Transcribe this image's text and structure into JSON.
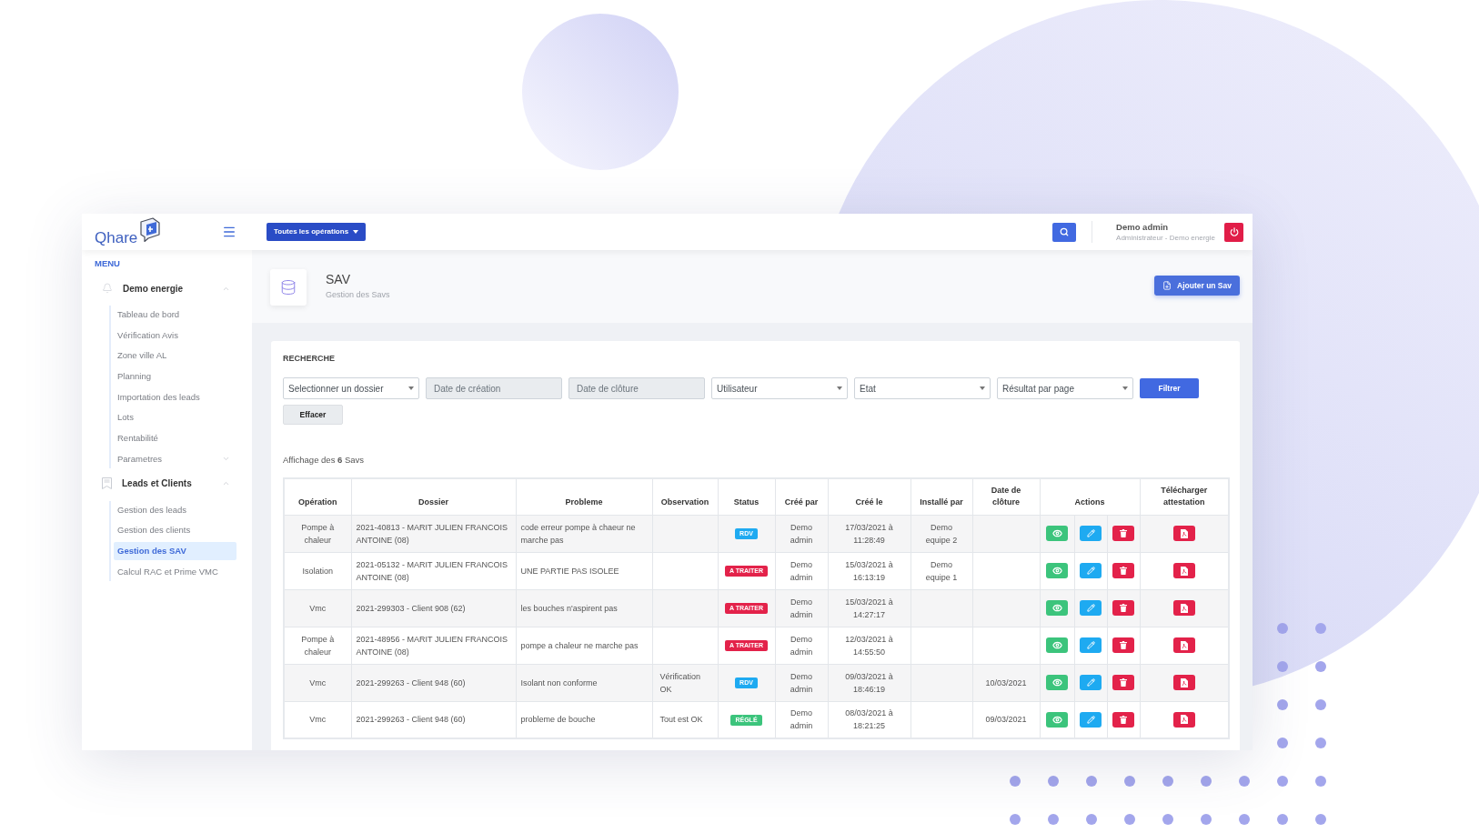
{
  "header": {
    "logo": "Qhare",
    "operations_menu": "Toutes les opérations",
    "user_name": "Demo admin",
    "user_role": "Administrateur - Demo energie"
  },
  "sidebar": {
    "title": "MENU",
    "sections": [
      {
        "title": "Demo energie",
        "expanded": true,
        "items": [
          {
            "kind": "link",
            "label": "Tableau de bord",
            "selected": false
          },
          {
            "kind": "link",
            "label": "Vérification Avis",
            "selected": false
          },
          {
            "kind": "link",
            "label": "Zone ville AL",
            "selected": false
          },
          {
            "kind": "link",
            "label": "Planning",
            "selected": false
          },
          {
            "kind": "link",
            "label": "Importation des leads",
            "selected": false
          },
          {
            "kind": "link",
            "label": "Lots",
            "selected": false
          },
          {
            "kind": "link",
            "label": "Rentabilité",
            "selected": false
          },
          {
            "kind": "submenu",
            "label": "Parametres",
            "selected": false,
            "expanded": false
          }
        ]
      },
      {
        "title": "Leads et Clients",
        "expanded": true,
        "items": [
          {
            "kind": "link",
            "label": "Gestion des leads",
            "selected": false
          },
          {
            "kind": "link",
            "label": "Gestion des clients",
            "selected": false
          },
          {
            "kind": "link",
            "label": "Gestion des SAV",
            "selected": true
          },
          {
            "kind": "link",
            "label": "Calcul RAC et Prime VMC",
            "selected": false
          }
        ]
      }
    ]
  },
  "page": {
    "title": "SAV",
    "subtitle": "Gestion des Savs",
    "add_button": "Ajouter un Sav"
  },
  "search": {
    "title": "RECHERCHE",
    "filters": [
      {
        "kind": "select",
        "placeholder": "Selectionner un dossier"
      },
      {
        "kind": "date",
        "placeholder": "Date de création"
      },
      {
        "kind": "date",
        "placeholder": "Date de clôture"
      },
      {
        "kind": "select",
        "placeholder": "Utilisateur"
      },
      {
        "kind": "select",
        "placeholder": "Etat"
      },
      {
        "kind": "select",
        "placeholder": "Résultat par page"
      }
    ],
    "filter_button": "Filtrer",
    "clear_button": "Effacer"
  },
  "summary": "Affichage des **6** Savs",
  "table": {
    "columns": [
      "Opération",
      "Dossier",
      "Probleme",
      "Observation",
      "Status",
      "Créé par",
      "Créé le",
      "Installé par",
      "Date de clôture",
      "Actions",
      "Télécharger attestation"
    ],
    "rows": [
      {
        "operation": "Pompe à chaleur",
        "dossier": "2021-40813 - MARIT JULIEN FRANCOIS ANTOINE (08)",
        "probleme": "code erreur pompe à chaeur ne marche pas",
        "status": {
          "label": "RDV",
          "color": "#1eaaf1"
        },
        "cree_par": "Demo admin",
        "cree_le": "17/03/2021 à 11:28:49",
        "installe_par": "Demo equipe 2"
      },
      {
        "operation": "Isolation",
        "dossier": "2021-05132 - MARIT JULIEN FRANCOIS ANTOINE (08)",
        "probleme": "UNE PARTIE PAS ISOLEE",
        "status": {
          "label": "A TRAITER",
          "color": "#e3224a"
        },
        "cree_par": "Demo admin",
        "cree_le": "15/03/2021 à 16:13:19",
        "installe_par": "Demo equipe 1"
      },
      {
        "operation": "Vmc",
        "dossier": "2021-299303 - Client 908 (62)",
        "probleme": "les bouches n'aspirent pas",
        "status": {
          "label": "A TRAITER",
          "color": "#e3224a"
        },
        "cree_par": "Demo admin",
        "cree_le": "15/03/2021 à 14:27:17"
      },
      {
        "operation": "Pompe à chaleur",
        "dossier": "2021-48956 - MARIT JULIEN FRANCOIS ANTOINE (08)",
        "probleme": "pompe a chaleur ne marche pas",
        "status": {
          "label": "A TRAITER",
          "color": "#e3224a"
        },
        "cree_par": "Demo admin",
        "cree_le": "12/03/2021 à 14:55:50"
      },
      {
        "operation": "Vmc",
        "dossier": "2021-299263 - Client 948 (60)",
        "probleme": "Isolant non conforme",
        "observation": "Vérification OK",
        "status": {
          "label": "RDV",
          "color": "#1eaaf1"
        },
        "cree_par": "Demo admin",
        "cree_le": "09/03/2021 à 18:46:19",
        "date_cloture": "10/03/2021"
      },
      {
        "operation": "Vmc",
        "dossier": "2021-299263 - Client 948 (60)",
        "probleme": "probleme de bouche",
        "observation": "Tout est OK",
        "status": {
          "label": "RÉGLÉ",
          "color": "#3cc47c"
        },
        "cree_par": "Demo admin",
        "cree_le": "08/03/2021 à 18:21:25",
        "date_cloture": "09/03/2021"
      }
    ]
  }
}
